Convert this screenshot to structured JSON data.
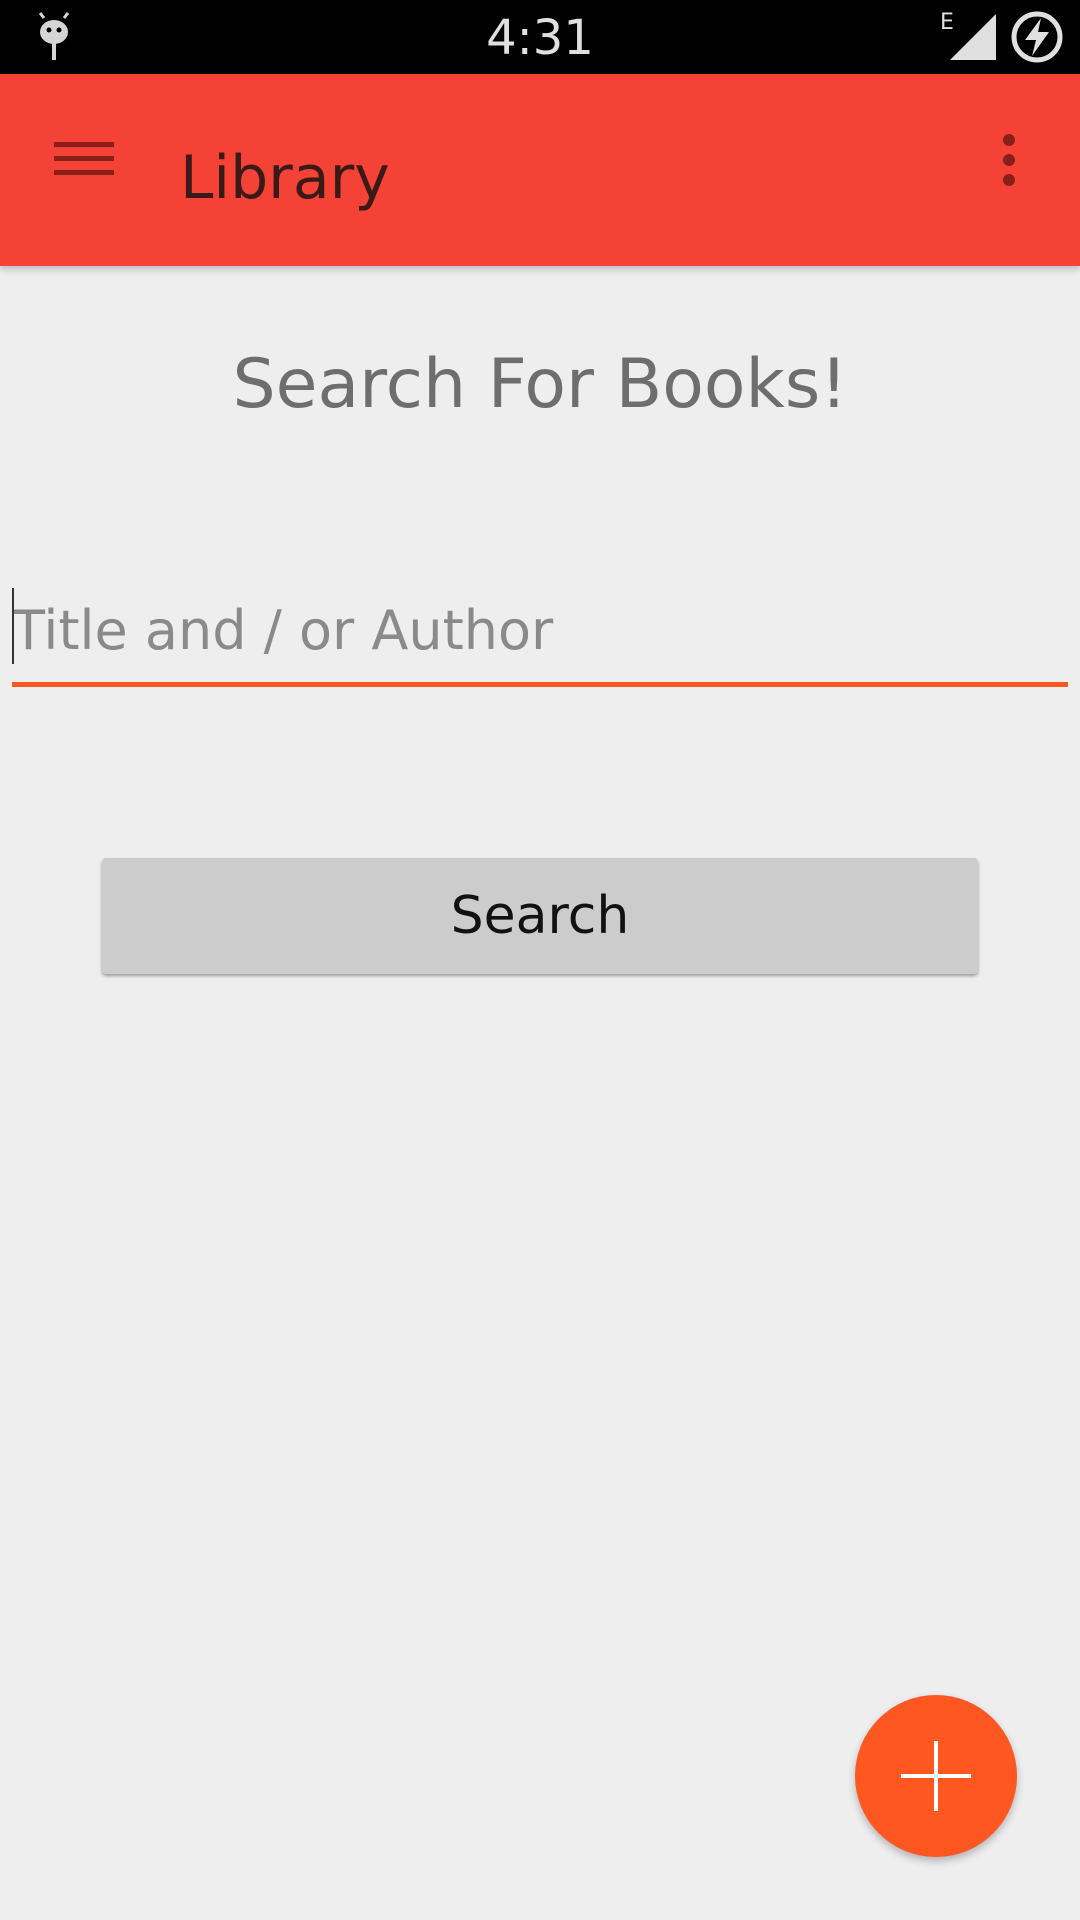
{
  "status_bar": {
    "time": "4:31",
    "network_type": "E",
    "icons": {
      "debug": "android-debug-icon",
      "signal": "signal-strength-icon",
      "battery": "battery-charging-icon"
    }
  },
  "app_bar": {
    "title": "Library",
    "menu_icon": "hamburger-menu-icon",
    "overflow_icon": "more-vert-icon"
  },
  "main": {
    "heading": "Search For Books!",
    "search_field": {
      "placeholder": "Title and / or Author",
      "value": ""
    },
    "search_button_label": "Search",
    "fab_icon": "add-icon"
  },
  "colors": {
    "app_bar": "#f44336",
    "app_bar_icons": "#8a1f19",
    "title_text": "#3a1a18",
    "accent": "#ff5722",
    "background": "#eeeeee",
    "heading_text": "#6e6e6e",
    "button_bg": "#cccccc"
  }
}
